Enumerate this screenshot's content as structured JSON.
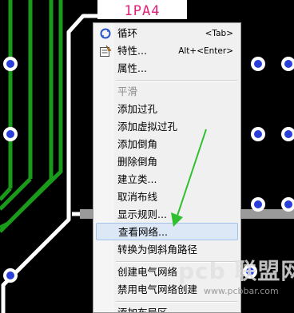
{
  "pcb": {
    "component_label": "1PA4"
  },
  "context_menu": {
    "items": [
      {
        "label": "循环",
        "shortcut": "<Tab>",
        "icon": "cycle-icon"
      },
      {
        "label": "特性...",
        "shortcut": "Alt+<Enter>",
        "icon": "properties-icon"
      },
      {
        "label": "属性...",
        "shortcut": ""
      },
      {
        "label": "平滑",
        "shortcut": "",
        "state": "disabled"
      },
      {
        "label": "添加过孔",
        "shortcut": ""
      },
      {
        "label": "添加虚拟过孔",
        "shortcut": ""
      },
      {
        "label": "添加倒角",
        "shortcut": ""
      },
      {
        "label": "删除倒角",
        "shortcut": ""
      },
      {
        "label": "建立类...",
        "shortcut": ""
      },
      {
        "label": "取消布线",
        "shortcut": ""
      },
      {
        "label": "显示规则...",
        "shortcut": ""
      },
      {
        "label": "查看网络...",
        "shortcut": "",
        "state": "highlighted"
      },
      {
        "label": "转换为倒斜角路径",
        "shortcut": ""
      },
      {
        "label": "创建电气网络",
        "shortcut": ""
      },
      {
        "label": "禁用电气网络创建",
        "shortcut": ""
      },
      {
        "label": "添加布局区",
        "shortcut": ""
      }
    ]
  },
  "watermark": {
    "brand": "pcb 联盟网",
    "url": "www.pcbbar.com"
  },
  "colors": {
    "background": "#000000",
    "trace": "#1a9a1a",
    "pad": "#2a3fd8",
    "label": "#e0207a",
    "arrow": "#2fbf2f",
    "highlight": "#dde8f6"
  }
}
